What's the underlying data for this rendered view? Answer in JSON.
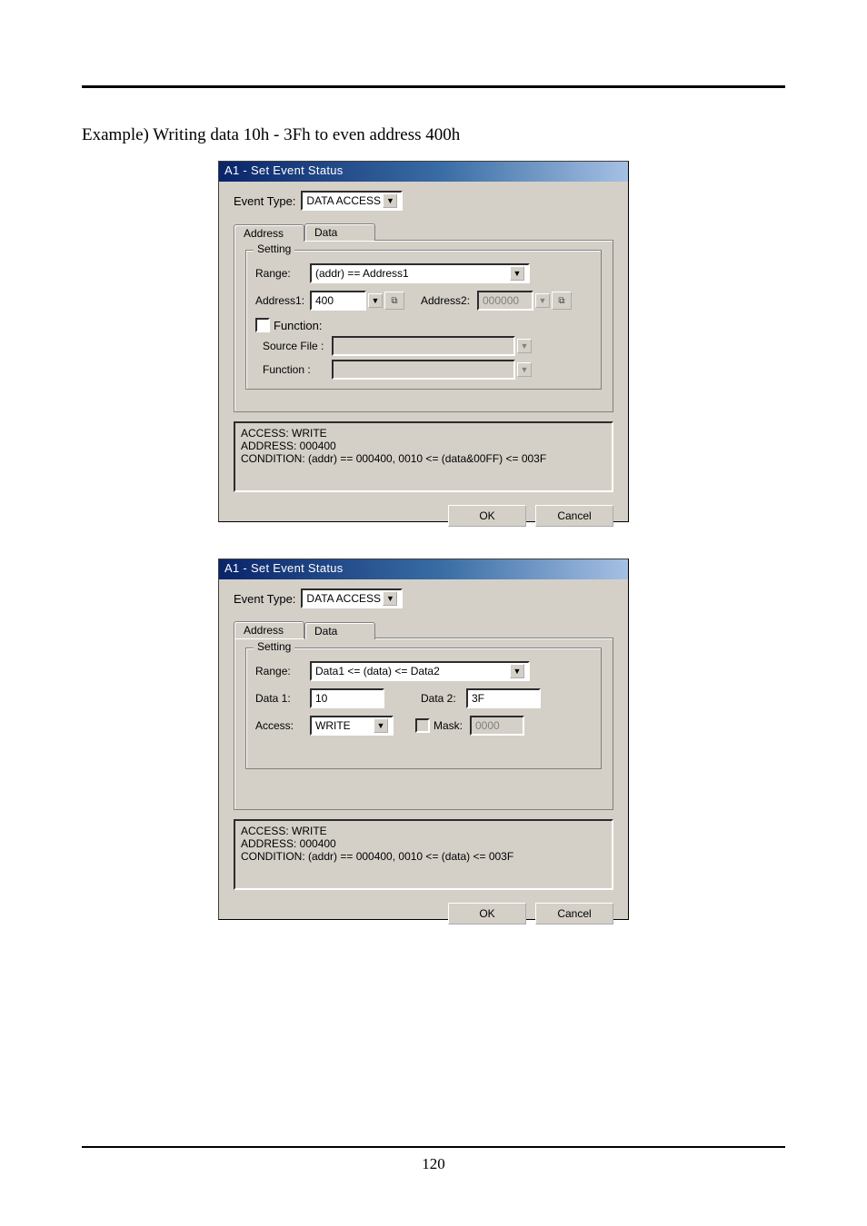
{
  "page": {
    "example_text": "Example) Writing data 10h - 3Fh to even address 400h",
    "number": "120"
  },
  "dlg1": {
    "title": "A1 - Set Event Status",
    "event_type_label": "Event Type:",
    "event_type_value": "DATA ACCESS",
    "tabs": {
      "address": "Address",
      "data": "Data"
    },
    "group_legend": "Setting",
    "range_label": "Range:",
    "range_value": "(addr) == Address1",
    "addr1_label": "Address1:",
    "addr1_value": "400",
    "addr2_label": "Address2:",
    "addr2_value": "000000",
    "func_chk_label": "Function:",
    "src_label": "Source File :",
    "func_label": "Function :",
    "status": "ACCESS: WRITE\nADDRESS: 000400\nCONDITION: (addr) == 000400, 0010 <= (data&00FF) <= 003F",
    "ok": "OK",
    "cancel": "Cancel"
  },
  "dlg2": {
    "title": "A1 - Set Event Status",
    "event_type_label": "Event Type:",
    "event_type_value": "DATA ACCESS",
    "tabs": {
      "address": "Address",
      "data": "Data"
    },
    "group_legend": "Setting",
    "range_label": "Range:",
    "range_value": "Data1 <= (data) <= Data2",
    "data1_label": "Data 1:",
    "data1_value": "10",
    "data2_label": "Data 2:",
    "data2_value": "3F",
    "access_label": "Access:",
    "access_value": "WRITE",
    "mask_label": "Mask:",
    "mask_value": "0000",
    "status": "ACCESS: WRITE\nADDRESS: 000400\nCONDITION: (addr) == 000400, 0010 <= (data) <= 003F",
    "ok": "OK",
    "cancel": "Cancel"
  }
}
